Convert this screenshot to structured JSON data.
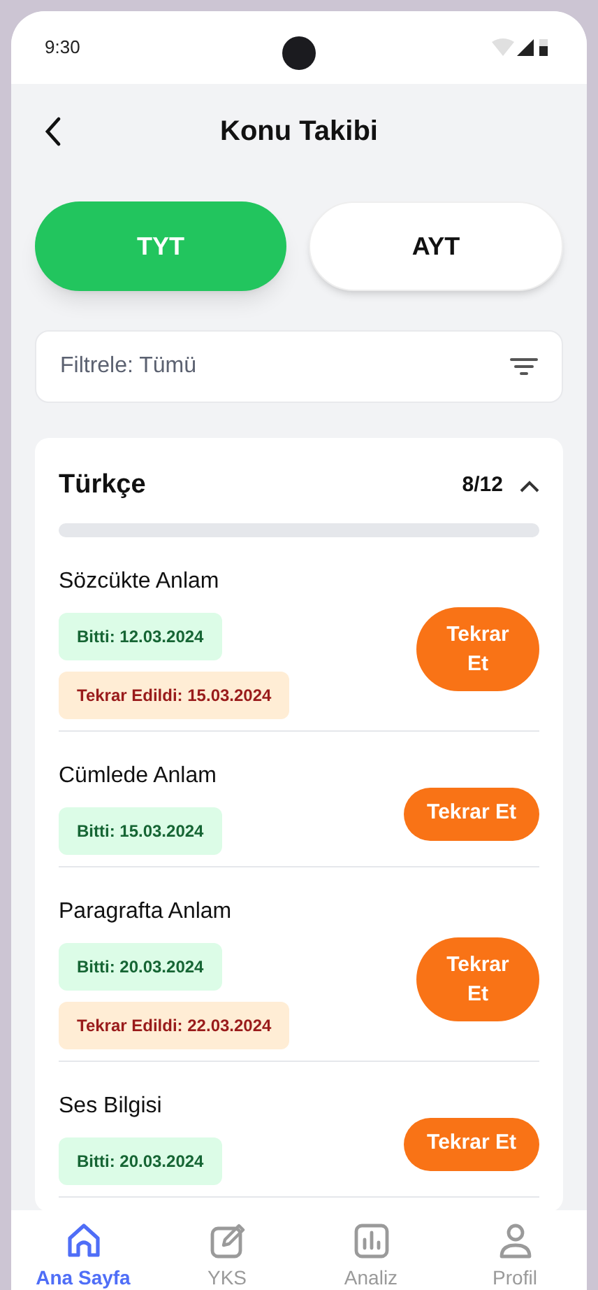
{
  "status_bar": {
    "time": "9:30"
  },
  "header": {
    "title": "Konu Takibi"
  },
  "tabs": [
    {
      "label": "TYT",
      "selected": true
    },
    {
      "label": "AYT",
      "selected": false
    }
  ],
  "filter": {
    "value": "Filtrele: Tümü"
  },
  "section": {
    "title": "Türkçe",
    "count": "8/12",
    "expanded": true,
    "level": 0,
    "topics": [
      {
        "name": "Sözcükte Anlam",
        "done": "Bitti: 12.03.2024",
        "repeated": "Tekrar Edildi: 15.03.2024",
        "button": "Tekrar Et"
      },
      {
        "name": "Cümlede Anlam",
        "done": "Bitti: 15.03.2024",
        "button": "Tekrar Et"
      },
      {
        "name": "Paragrafta Anlam",
        "done": "Bitti: 20.03.2024",
        "repeated": "Tekrar Edildi: 22.03.2024",
        "button": "Tekrar Et"
      },
      {
        "name": "Ses Bilgisi",
        "done": "Bitti: 20.03.2024",
        "button": "Tekrar Et"
      }
    ]
  },
  "bottom_nav": [
    {
      "kind": "home",
      "label": "Ana Sayfa",
      "selected": true
    },
    {
      "kind": "edit",
      "label": "YKS",
      "selected": false
    },
    {
      "kind": "chart",
      "label": "Analiz",
      "selected": false
    },
    {
      "kind": "profile",
      "label": "Profil",
      "selected": false
    }
  ]
}
